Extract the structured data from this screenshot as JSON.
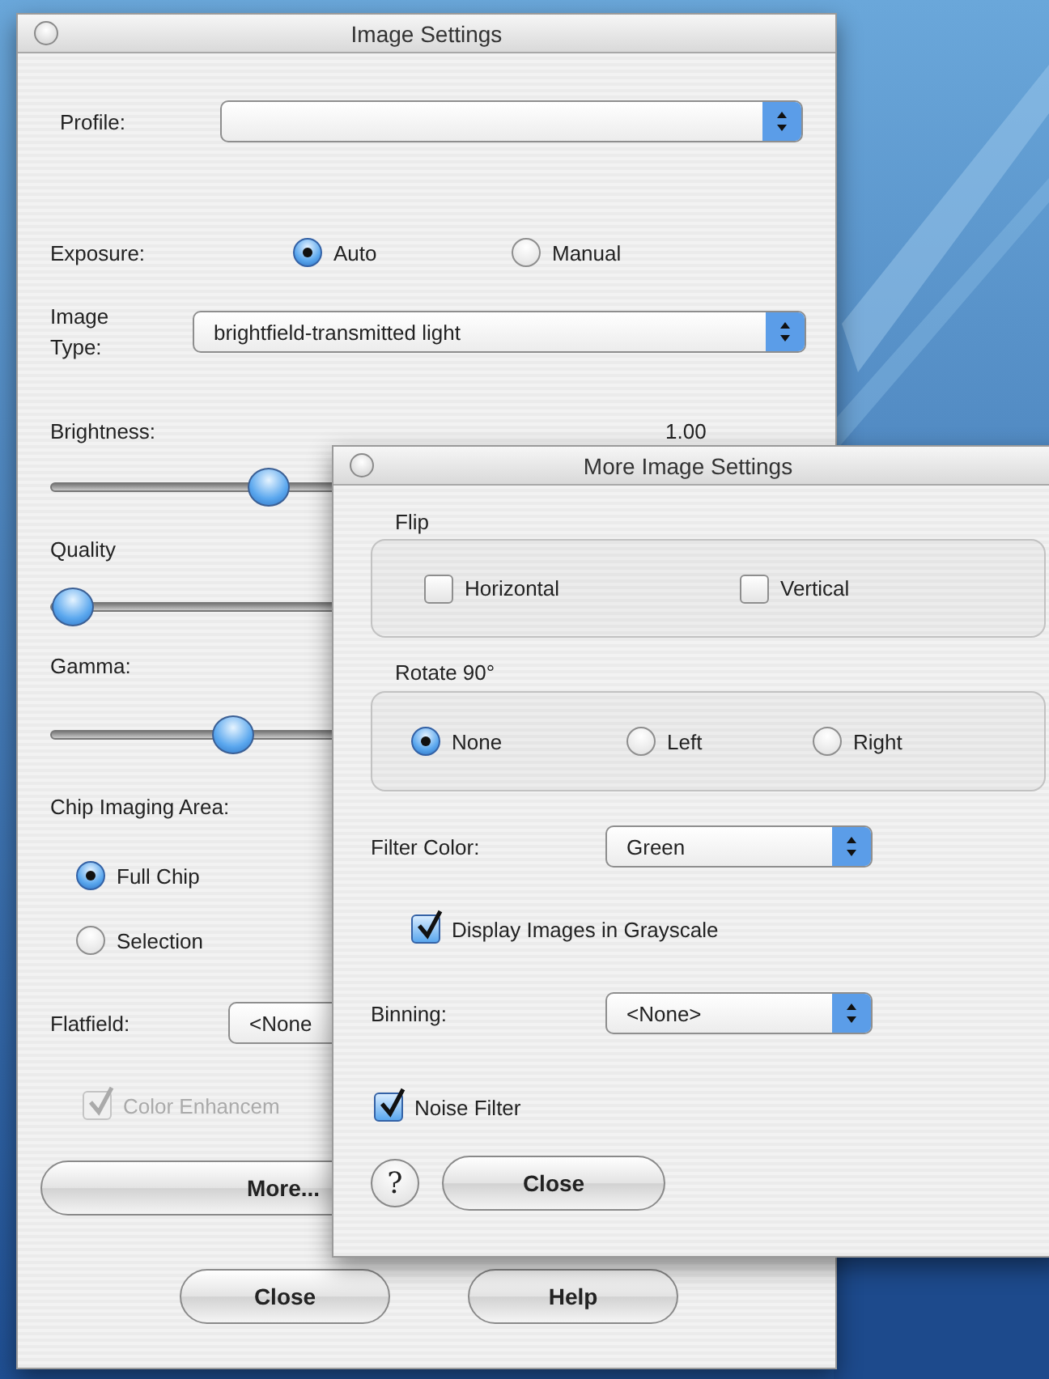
{
  "main_window": {
    "title": "Image Settings",
    "profile": {
      "label": "Profile:"
    },
    "exposure": {
      "label": "Exposure:",
      "options": [
        {
          "label": "Auto",
          "selected": true
        },
        {
          "label": "Manual",
          "selected": false
        }
      ]
    },
    "image_type": {
      "label": "Image Type:",
      "value": "brightfield-transmitted light"
    },
    "sliders": [
      {
        "label": "Brightness:",
        "reading": "1.00",
        "level": 0.3
      },
      {
        "label": "Quality",
        "level": 0
      },
      {
        "label": "Gamma:",
        "level": 0.245
      }
    ],
    "chip_imaging_area": {
      "label": "Chip Imaging Area:",
      "options": [
        {
          "label": "Full Chip",
          "selected": true
        },
        {
          "label": "Selection",
          "selected": false
        }
      ]
    },
    "flatfield": {
      "label": "Flatfield:",
      "value": "<None"
    },
    "color_enhancement": {
      "label": "Color Enhancem",
      "checked": true,
      "disabled": true
    },
    "more_button": "More...",
    "footer_buttons": [
      "Close",
      "Help"
    ]
  },
  "more_window": {
    "title": "More Image Settings",
    "flip": {
      "label": "Flip",
      "options": [
        {
          "label": "Horizontal",
          "checked": false
        },
        {
          "label": "Vertical",
          "checked": false
        }
      ]
    },
    "rotate": {
      "label": "Rotate 90°",
      "options": [
        {
          "label": "None",
          "selected": true
        },
        {
          "label": "Left",
          "selected": false
        },
        {
          "label": "Right",
          "selected": false
        }
      ]
    },
    "filter_color": {
      "label": "Filter Color:",
      "value": "Green"
    },
    "grayscale": {
      "label": "Display Images in Grayscale",
      "checked": true
    },
    "binning": {
      "label": "Binning:",
      "value": "<None>"
    },
    "noise_filter": {
      "label": "Noise Filter",
      "checked": true
    },
    "help_button": "?",
    "close_button": "Close"
  }
}
